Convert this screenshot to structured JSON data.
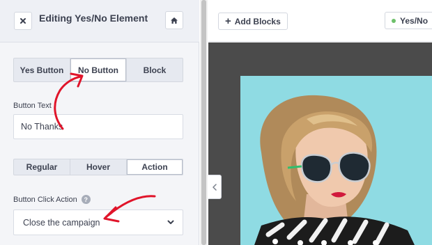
{
  "header": {
    "title": "Editing Yes/No Element",
    "close_icon": "close-icon",
    "home_icon": "home-icon"
  },
  "button_type_tabs": [
    {
      "label": "Yes Button",
      "active": false
    },
    {
      "label": "No Button",
      "active": true
    },
    {
      "label": "Block",
      "active": false
    }
  ],
  "button_text": {
    "label": "Button Text",
    "value": "No Thanks"
  },
  "state_tabs": [
    {
      "label": "Regular",
      "active": false
    },
    {
      "label": "Hover",
      "active": false
    },
    {
      "label": "Action",
      "active": true
    }
  ],
  "click_action": {
    "label": "Button Click Action",
    "help_icon": "?",
    "selected": "Close the campaign"
  },
  "toolbar": {
    "add_blocks_label": "Add Blocks",
    "yesno_label": "Yes/No",
    "yesno_status_color": "#6ec06b"
  },
  "annotations": {
    "arrow_color": "#e0142a"
  },
  "canvas": {
    "background": "#4b4b4b",
    "photo_background": "#8fdbe3"
  }
}
